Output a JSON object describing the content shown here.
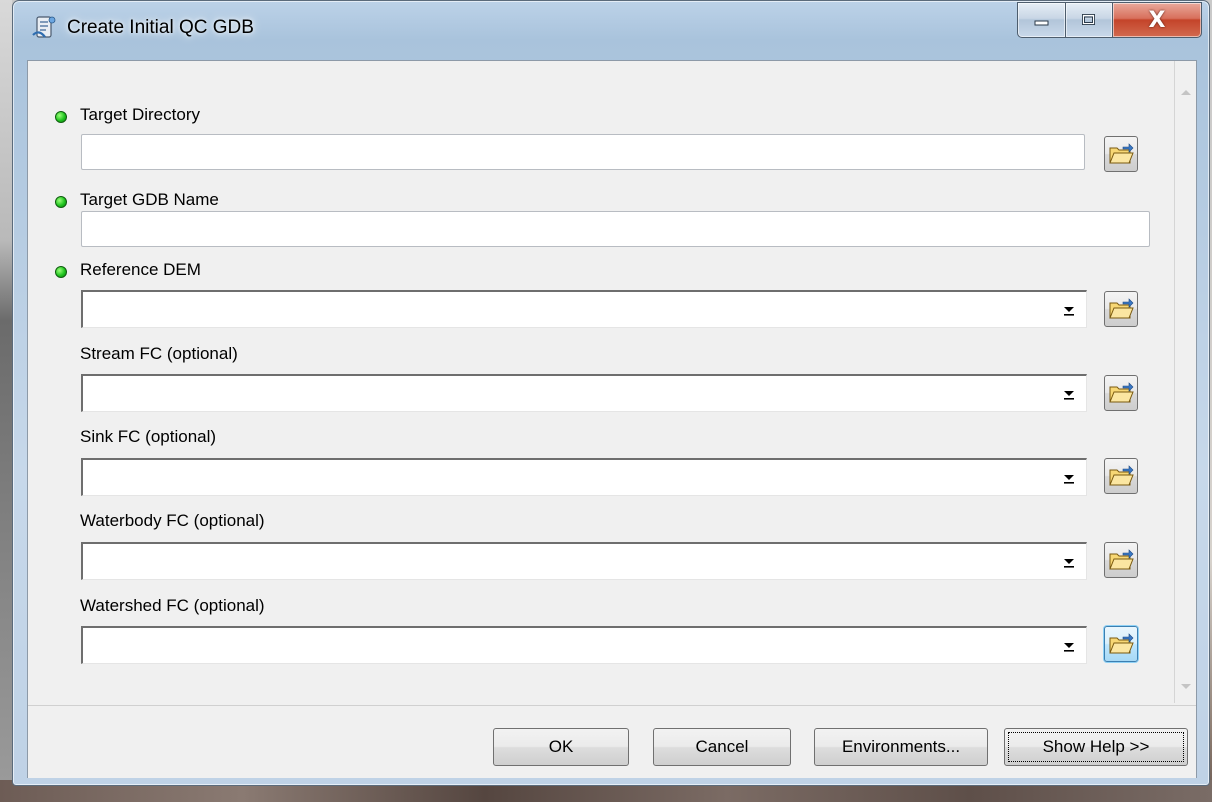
{
  "window": {
    "title": "Create Initial QC GDB",
    "caption_buttons": {
      "minimize_icon": "minimize-icon",
      "maximize_icon": "maximize-icon",
      "close_label": "X"
    }
  },
  "parameters": [
    {
      "label": "Target Directory",
      "required": true,
      "control": "text",
      "value": "",
      "browse": true
    },
    {
      "label": "Target GDB Name",
      "required": true,
      "control": "text",
      "value": "",
      "browse": false
    },
    {
      "label": "Reference DEM",
      "required": true,
      "control": "combo",
      "value": "",
      "browse": true
    },
    {
      "label": "Stream FC (optional)",
      "required": false,
      "control": "combo",
      "value": "",
      "browse": true
    },
    {
      "label": "Sink FC (optional)",
      "required": false,
      "control": "combo",
      "value": "",
      "browse": true
    },
    {
      "label": "Waterbody FC (optional)",
      "required": false,
      "control": "combo",
      "value": "",
      "browse": true
    },
    {
      "label": "Watershed FC (optional)",
      "required": false,
      "control": "combo",
      "value": "",
      "browse": true,
      "active": true
    }
  ],
  "buttons": {
    "ok": "OK",
    "cancel": "Cancel",
    "environments": "Environments...",
    "show_help": "Show Help >>"
  },
  "icons": {
    "app": "toolbox-script-icon",
    "browse": "open-folder-icon",
    "required": "required-dot-icon",
    "dropdown": "dropdown-arrow-icon"
  },
  "colors": {
    "required_dot": "#1fc41f",
    "active_button": "#bee6fd",
    "close_button": "#c4442a"
  }
}
